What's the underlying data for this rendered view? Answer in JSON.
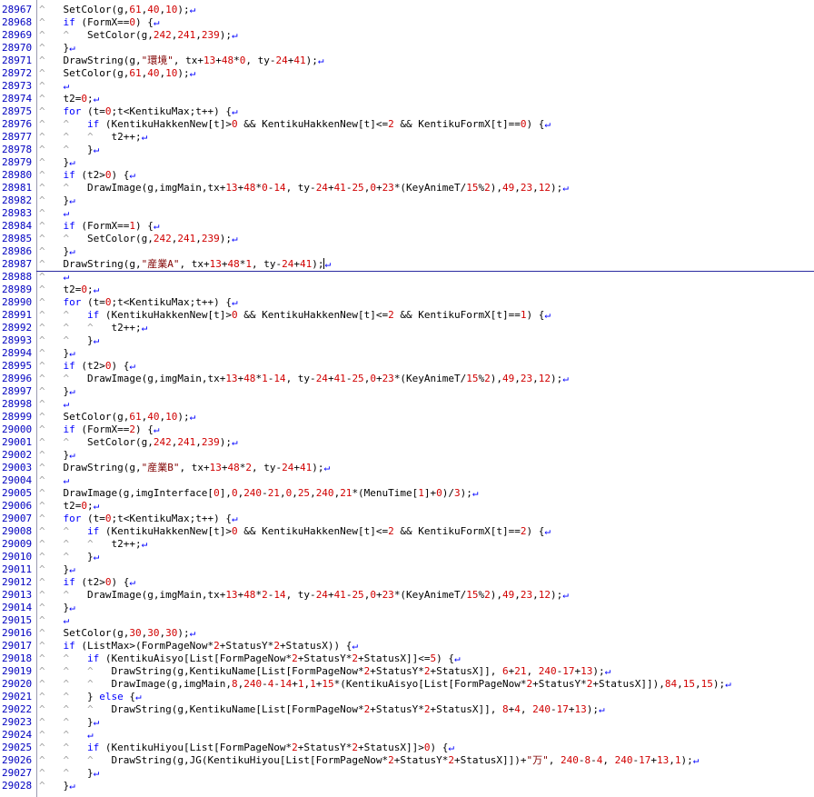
{
  "editor": {
    "eol_marker": "↵",
    "tab_marker": "^",
    "lines": [
      {
        "n": "28967",
        "t": "    SetColor(g,61,40,10);"
      },
      {
        "n": "28968",
        "t": "    if (FormX==0) {"
      },
      {
        "n": "28969",
        "t": "        SetColor(g,242,241,239);"
      },
      {
        "n": "28970",
        "t": "    }"
      },
      {
        "n": "28971",
        "t": "    DrawString(g,\"環境\", tx+13+48*0, ty-24+41);"
      },
      {
        "n": "28972",
        "t": "    SetColor(g,61,40,10);"
      },
      {
        "n": "28973",
        "t": "    "
      },
      {
        "n": "28974",
        "t": "    t2=0;"
      },
      {
        "n": "28975",
        "t": "    for (t=0;t<KentikuMax;t++) {"
      },
      {
        "n": "28976",
        "t": "        if (KentikuHakkenNew[t]>0 && KentikuHakkenNew[t]<=2 && KentikuFormX[t]==0) {"
      },
      {
        "n": "28977",
        "t": "            t2++;"
      },
      {
        "n": "28978",
        "t": "        }"
      },
      {
        "n": "28979",
        "t": "    }"
      },
      {
        "n": "28980",
        "t": "    if (t2>0) {"
      },
      {
        "n": "28981",
        "t": "        DrawImage(g,imgMain,tx+13+48*0-14, ty-24+41-25,0+23*(KeyAnimeT/15%2),49,23,12);"
      },
      {
        "n": "28982",
        "t": "    }"
      },
      {
        "n": "28983",
        "t": "    "
      },
      {
        "n": "28984",
        "t": "    if (FormX==1) {"
      },
      {
        "n": "28985",
        "t": "        SetColor(g,242,241,239);"
      },
      {
        "n": "28986",
        "t": "    }"
      },
      {
        "n": "28987",
        "t": "    DrawString(g,\"産業A\", tx+13+48*1, ty-24+41);"
      },
      {
        "n": "28988",
        "t": "    "
      },
      {
        "n": "28989",
        "t": "    t2=0;"
      },
      {
        "n": "28990",
        "t": "    for (t=0;t<KentikuMax;t++) {"
      },
      {
        "n": "28991",
        "t": "        if (KentikuHakkenNew[t]>0 && KentikuHakkenNew[t]<=2 && KentikuFormX[t]==1) {"
      },
      {
        "n": "28992",
        "t": "            t2++;"
      },
      {
        "n": "28993",
        "t": "        }"
      },
      {
        "n": "28994",
        "t": "    }"
      },
      {
        "n": "28995",
        "t": "    if (t2>0) {"
      },
      {
        "n": "28996",
        "t": "        DrawImage(g,imgMain,tx+13+48*1-14, ty-24+41-25,0+23*(KeyAnimeT/15%2),49,23,12);"
      },
      {
        "n": "28997",
        "t": "    }"
      },
      {
        "n": "28998",
        "t": "    "
      },
      {
        "n": "28999",
        "t": "    SetColor(g,61,40,10);"
      },
      {
        "n": "29000",
        "t": "    if (FormX==2) {"
      },
      {
        "n": "29001",
        "t": "        SetColor(g,242,241,239);"
      },
      {
        "n": "29002",
        "t": "    }"
      },
      {
        "n": "29003",
        "t": "    DrawString(g,\"産業B\", tx+13+48*2, ty-24+41);"
      },
      {
        "n": "29004",
        "t": "    "
      },
      {
        "n": "29005",
        "t": "    DrawImage(g,imgInterface[0],0,240-21,0,25,240,21*(MenuTime[1]+0)/3);"
      },
      {
        "n": "29006",
        "t": "    t2=0;"
      },
      {
        "n": "29007",
        "t": "    for (t=0;t<KentikuMax;t++) {"
      },
      {
        "n": "29008",
        "t": "        if (KentikuHakkenNew[t]>0 && KentikuHakkenNew[t]<=2 && KentikuFormX[t]==2) {"
      },
      {
        "n": "29009",
        "t": "            t2++;"
      },
      {
        "n": "29010",
        "t": "        }"
      },
      {
        "n": "29011",
        "t": "    }"
      },
      {
        "n": "29012",
        "t": "    if (t2>0) {"
      },
      {
        "n": "29013",
        "t": "        DrawImage(g,imgMain,tx+13+48*2-14, ty-24+41-25,0+23*(KeyAnimeT/15%2),49,23,12);"
      },
      {
        "n": "29014",
        "t": "    }"
      },
      {
        "n": "29015",
        "t": "    "
      },
      {
        "n": "29016",
        "t": "    SetColor(g,30,30,30);"
      },
      {
        "n": "29017",
        "t": "    if (ListMax>(FormPageNow*2+StatusY*2+StatusX)) {"
      },
      {
        "n": "29018",
        "t": "        if (KentikuAisyo[List[FormPageNow*2+StatusY*2+StatusX]]<=5) {"
      },
      {
        "n": "29019",
        "t": "            DrawString(g,KentikuName[List[FormPageNow*2+StatusY*2+StatusX]], 6+21, 240-17+13);"
      },
      {
        "n": "29020",
        "t": "            DrawImage(g,imgMain,8,240-4-14+1,1+15*(KentikuAisyo[List[FormPageNow*2+StatusY*2+StatusX]]),84,15,15);"
      },
      {
        "n": "29021",
        "t": "        } else {"
      },
      {
        "n": "29022",
        "t": "            DrawString(g,KentikuName[List[FormPageNow*2+StatusY*2+StatusX]], 8+4, 240-17+13);"
      },
      {
        "n": "29023",
        "t": "        }"
      },
      {
        "n": "29024",
        "t": "        "
      },
      {
        "n": "29025",
        "t": "        if (KentikuHiyou[List[FormPageNow*2+StatusY*2+StatusX]]>0) {"
      },
      {
        "n": "29026",
        "t": "            DrawString(g,JG(KentikuHiyou[List[FormPageNow*2+StatusY*2+StatusX]])+\"万\", 240-8-4, 240-17+13,1);"
      },
      {
        "n": "29027",
        "t": "        }"
      },
      {
        "n": "29028",
        "t": "    }"
      }
    ],
    "cursor_line": "28987"
  }
}
